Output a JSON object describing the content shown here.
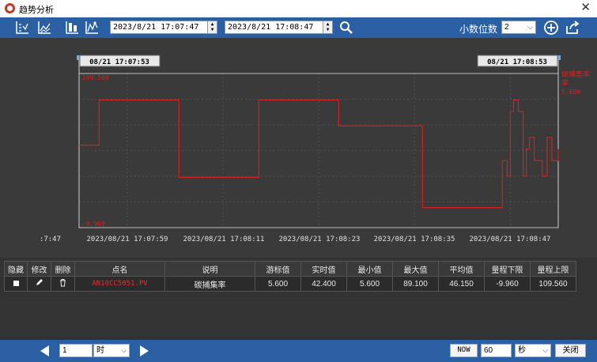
{
  "window": {
    "title": "趋势分析",
    "close_glyph": "✕"
  },
  "toolbar": {
    "start_time": "2023/8/21 17:07:47",
    "end_time": "2023/8/21 17:08:47",
    "decimal_label": "小数位数",
    "decimal_value": "2"
  },
  "chart": {
    "cursor_left": "08/21 17:07:53",
    "cursor_right": "08/21 17:08:53",
    "ymax_label": "109.560",
    "ymin_label": "-9.960",
    "legend_name_line1": "碳捕集率",
    "legend_name_line2": "率",
    "legend_value": "5.600",
    "x_tick_labels": [
      ":7:47",
      "2023/08/21 17:07:59",
      "2023/08/21 17:08:11",
      "2023/08/21 17:08:23",
      "2023/08/21 17:08:35",
      "2023/08/21 17:08:47"
    ],
    "line_color": "#d42020"
  },
  "chart_data": {
    "type": "line",
    "title": "",
    "xlabel": "",
    "ylabel": "",
    "ylim": [
      -9.96,
      109.56
    ],
    "x_ticks": [
      "2023/08/21 17:07:59",
      "2023/08/21 17:08:11",
      "2023/08/21 17:08:23",
      "2023/08/21 17:08:35",
      "2023/08/21 17:08:47"
    ],
    "series": [
      {
        "name": "碳捕集率",
        "step": true,
        "x": [
          "17:07:53",
          "17:07:55.5",
          "17:08:05.5",
          "17:08:15.5",
          "17:08:25.5",
          "17:08:36",
          "17:08:46",
          "17:08:46.6",
          "17:08:47",
          "17:08:47.4",
          "17:08:48",
          "17:08:48.6",
          "17:08:49",
          "17:08:49.4",
          "17:08:50",
          "17:08:51",
          "17:08:51.6",
          "17:08:52.2",
          "17:08:53"
        ],
        "y": [
          54,
          89,
          29,
          89,
          69,
          5.6,
          42,
          30,
          80,
          89,
          80,
          30,
          51,
          60,
          42,
          30,
          60,
          42,
          51
        ]
      }
    ]
  },
  "table": {
    "headers": [
      "隐藏",
      "修改",
      "删除",
      "点名",
      "说明",
      "游标值",
      "实时值",
      "最小值",
      "最大值",
      "平均值",
      "量程下限",
      "量程上限"
    ],
    "rows": [
      {
        "point": "AN10CC5051.PV",
        "desc": "碳捕集率",
        "cursor": "5.600",
        "realtime": "42.400",
        "min": "5.600",
        "max": "89.100",
        "avg": "46.150",
        "range_low": "-9.960",
        "range_high": "109.560"
      }
    ]
  },
  "bottom": {
    "page_value": "1",
    "unit_value": "时",
    "now_label": "NOW",
    "interval_value": "60",
    "interval_unit": "秒",
    "close_label": "关闭"
  }
}
